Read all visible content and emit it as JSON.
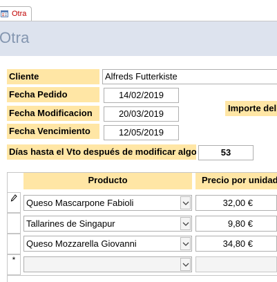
{
  "tab": {
    "label": "Otra",
    "icon": "form-icon"
  },
  "form": {
    "title": "Otra"
  },
  "fields": {
    "cliente": {
      "label": "Cliente",
      "value": "Alfreds Futterkiste"
    },
    "fecha_pedido": {
      "label": "Fecha Pedido",
      "value": "14/02/2019"
    },
    "fecha_modificacion": {
      "label": "Fecha Modificacion",
      "value": "20/03/2019"
    },
    "fecha_vencimiento": {
      "label": "Fecha Vencimiento",
      "value": "12/05/2019"
    },
    "importe": {
      "label": "Importe del"
    },
    "dias_vto": {
      "label": "Días hasta el Vto después de modificar algo",
      "value": "53"
    }
  },
  "grid": {
    "headers": {
      "producto": "Producto",
      "precio": "Precio por unidad"
    },
    "rows": [
      {
        "producto": "Queso Mascarpone Fabioli",
        "precio": "32,00 €",
        "selector": "pencil-icon"
      },
      {
        "producto": "Tallarines de Singapur",
        "precio": "9,80 €",
        "selector": ""
      },
      {
        "producto": "Queso Mozzarella Giovanni",
        "precio": "34,80 €",
        "selector": ""
      }
    ],
    "new_row_marker": "*"
  },
  "colors": {
    "label_bg": "#ffe6a5",
    "header_bg": "#dde3ee",
    "title": "#8496b0",
    "tab_text": "#c00000"
  }
}
